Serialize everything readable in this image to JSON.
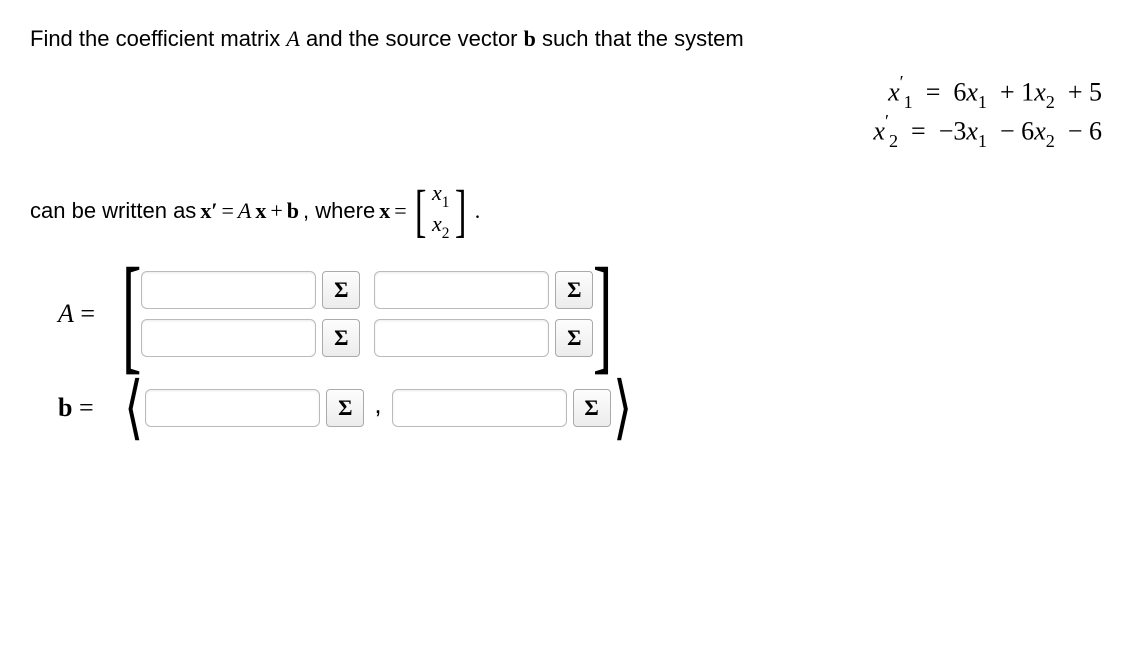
{
  "prompt": {
    "part1": "Find the coefficient matrix ",
    "A": "A",
    "part2": " and the source vector ",
    "b": "b",
    "part3": " such that the system"
  },
  "equations": {
    "row1": {
      "lhs_var": "x",
      "lhs_sup": "′",
      "lhs_sub": "1",
      "eq": " = ",
      "rhs": "6x₁ + 1x₂ + 5"
    },
    "row2": {
      "lhs_var": "x",
      "lhs_sup": "′",
      "lhs_sub": "2",
      "eq": " = ",
      "rhs": "−3x₁ − 6x₂ − 6"
    },
    "row1_full": "x′₁ = 6x₁ + 1x₂ + 5",
    "row2_full": "x′₂ = −3x₁ − 6x₂ − 6"
  },
  "line2": {
    "part1": "can be written as ",
    "xprime": "x′",
    "eq1": " = ",
    "Ax": "A",
    "xbold": "x",
    "plus": " + ",
    "bbold": "b",
    "comma_where": ", where ",
    "xbold2": "x",
    "eq2": " = ",
    "col1": "x₁",
    "col2": "x₂",
    "period": "."
  },
  "answers": {
    "matrixLabel": "A = ",
    "vectorLabel": "b = ",
    "sigma": "Σ",
    "comma": ",",
    "A": {
      "r1c1": "",
      "r1c2": "",
      "r2c1": "",
      "r2c2": ""
    },
    "b": {
      "c1": "",
      "c2": ""
    }
  }
}
